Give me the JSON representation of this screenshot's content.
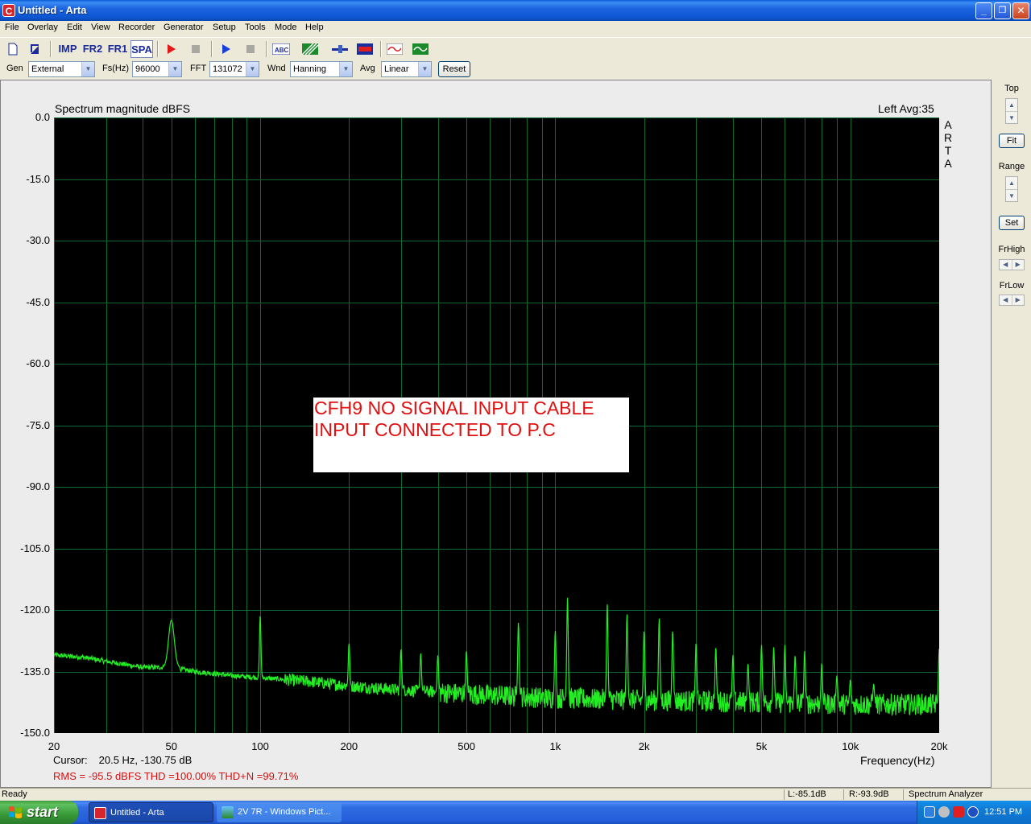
{
  "window": {
    "title": "Untitled - Arta",
    "app_icon": "arta-logo-icon",
    "controls": {
      "minimize": "_",
      "maximize": "❐",
      "close": "✕"
    }
  },
  "menu": [
    "File",
    "Overlay",
    "Edit",
    "View",
    "Recorder",
    "Generator",
    "Setup",
    "Tools",
    "Mode",
    "Help"
  ],
  "toolbar1": {
    "imp": "IMP",
    "fr2": "FR2",
    "fr1": "FR1",
    "spa": "SPA"
  },
  "toolbar2": {
    "gen_label": "Gen",
    "gen_value": "External",
    "fs_label": "Fs(Hz)",
    "fs_value": "96000",
    "fft_label": "FFT",
    "fft_value": "131072",
    "wnd_label": "Wnd",
    "wnd_value": "Hanning",
    "avg_label": "Avg",
    "avg_value": "Linear",
    "reset": "Reset"
  },
  "plot": {
    "title": "Spectrum magnitude dBFS",
    "status": "Left   Avg:35",
    "brand_vertical": [
      "A",
      "R",
      "T",
      "A"
    ],
    "xaxis_label": "Frequency(Hz)",
    "cursor_label": "Cursor:",
    "cursor_value": "20.5 Hz, -130.75 dB",
    "measurements": "RMS =  -95.5 dBFS    THD =100.00%    THD+N =99.71%",
    "annotation_line1": "CFH9 NO SIGNAL INPUT CABLE",
    "annotation_line2": "INPUT CONNECTED TO P.C"
  },
  "chart_data": {
    "type": "line",
    "title": "Spectrum magnitude dBFS",
    "xlabel": "Frequency(Hz)",
    "ylabel": "",
    "xscale": "log",
    "xlim": [
      20,
      20000
    ],
    "ylim": [
      -150,
      0
    ],
    "grid": true,
    "y_ticks": [
      "0.0",
      "-15.0",
      "-30.0",
      "-45.0",
      "-60.0",
      "-75.0",
      "-90.0",
      "-105.0",
      "-120.0",
      "-135.0",
      "-150.0"
    ],
    "x_ticks": [
      {
        "label": "20",
        "value": 20
      },
      {
        "label": "50",
        "value": 50
      },
      {
        "label": "100",
        "value": 100
      },
      {
        "label": "200",
        "value": 200
      },
      {
        "label": "500",
        "value": 500
      },
      {
        "label": "1k",
        "value": 1000
      },
      {
        "label": "2k",
        "value": 2000
      },
      {
        "label": "5k",
        "value": 5000
      },
      {
        "label": "10k",
        "value": 10000
      },
      {
        "label": "20k",
        "value": 20000
      }
    ],
    "series": [
      {
        "color": "#22ee22",
        "noise_floor": [
          [
            20,
            -131
          ],
          [
            25,
            -131.5
          ],
          [
            30,
            -132.5
          ],
          [
            40,
            -134
          ],
          [
            50,
            -134
          ],
          [
            60,
            -135
          ],
          [
            80,
            -136
          ],
          [
            100,
            -136.5
          ],
          [
            150,
            -137.5
          ],
          [
            200,
            -138.5
          ],
          [
            300,
            -139.5
          ],
          [
            500,
            -140.5
          ],
          [
            1000,
            -141.5
          ],
          [
            2000,
            -142
          ],
          [
            5000,
            -142.5
          ],
          [
            10000,
            -143
          ],
          [
            20000,
            -143
          ]
        ],
        "peaks": [
          [
            50,
            -122.5
          ],
          [
            100,
            -121.5
          ],
          [
            200,
            -128
          ],
          [
            300,
            -129.5
          ],
          [
            350,
            -130.5
          ],
          [
            400,
            -131
          ],
          [
            500,
            -130
          ],
          [
            750,
            -123
          ],
          [
            1000,
            -125
          ],
          [
            1100,
            -117
          ],
          [
            1500,
            -118.5
          ],
          [
            1750,
            -121
          ],
          [
            2000,
            -125
          ],
          [
            2250,
            -122
          ],
          [
            2500,
            -125
          ],
          [
            3000,
            -128
          ],
          [
            3500,
            -129
          ],
          [
            4000,
            -131
          ],
          [
            4500,
            -133
          ],
          [
            5000,
            -128.5
          ],
          [
            5500,
            -129
          ],
          [
            6000,
            -128.5
          ],
          [
            6500,
            -131
          ],
          [
            7000,
            -130
          ],
          [
            8000,
            -133
          ],
          [
            9000,
            -136
          ],
          [
            10000,
            -137
          ],
          [
            12000,
            -138
          ],
          [
            20000,
            -129.5
          ]
        ]
      }
    ]
  },
  "side": {
    "top_label": "Top",
    "fit": "Fit",
    "range_label": "Range",
    "set": "Set",
    "frhigh_label": "FrHigh",
    "frlow_label": "FrLow"
  },
  "status": {
    "left": "Ready",
    "l_level": "L:-85.1dB",
    "r_level": "R:-93.9dB",
    "mode": "Spectrum Analyzer"
  },
  "taskbar": {
    "start": "start",
    "tasks": [
      "Untitled - Arta",
      "2V 7R - Windows Pict..."
    ],
    "clock": "12:51 PM"
  }
}
